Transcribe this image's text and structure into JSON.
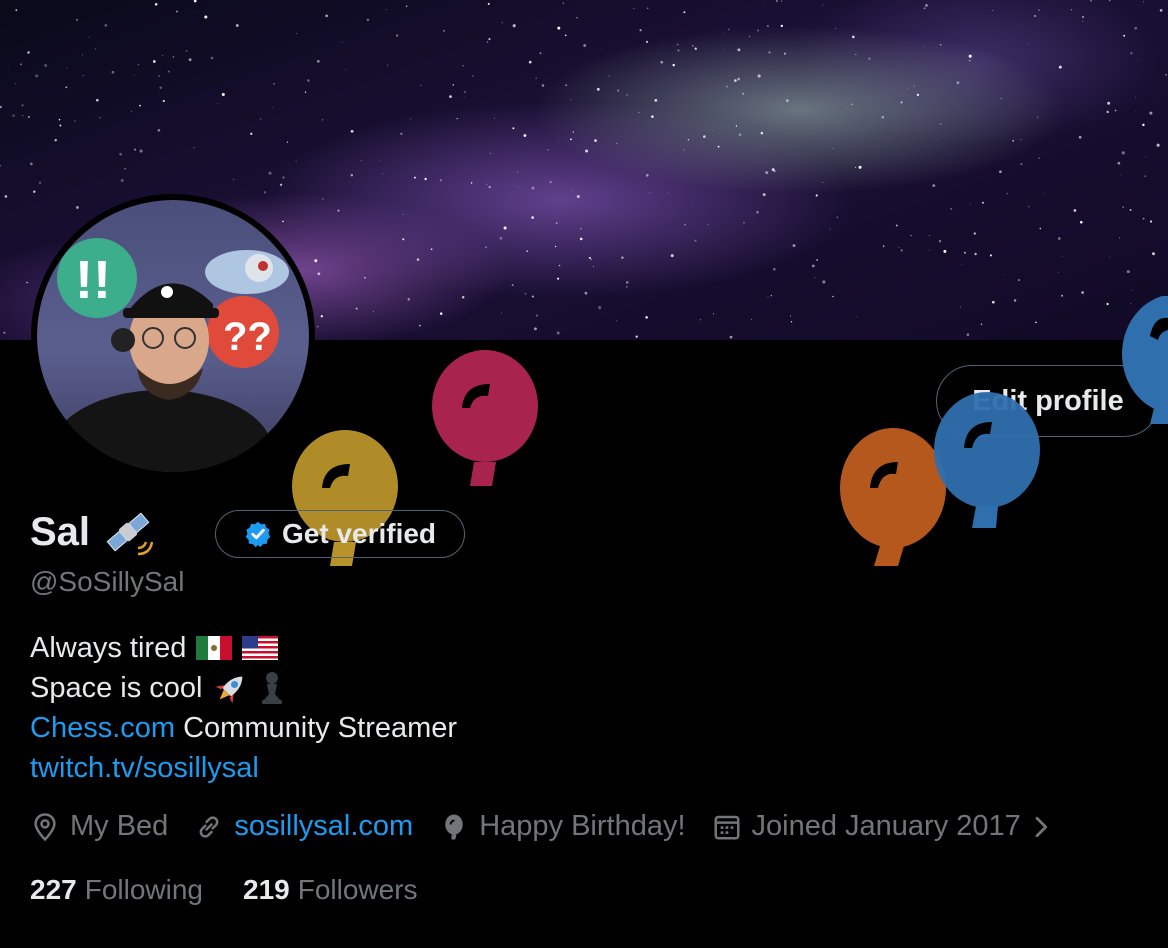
{
  "profile": {
    "name": "Sal",
    "handle": "@SoSillySal",
    "edit_profile_label": "Edit profile",
    "get_verified_label": "Get verified",
    "name_emoji_icon": "satellite-icon",
    "bio": {
      "line1": "Always tired",
      "line2": "Space is cool",
      "line3_link": "Chess.com",
      "line3_text": " Community Streamer",
      "line4_link": "twitch.tv/sosillysal"
    },
    "meta": {
      "location": "My Bed",
      "website": "sosillysal.com",
      "birthday": "Happy Birthday!",
      "joined": "Joined January 2017"
    },
    "stats": {
      "following_count": "227",
      "following_label": "Following",
      "followers_count": "219",
      "followers_label": "Followers"
    }
  },
  "colors": {
    "background": "#000000",
    "text_primary": "#e7e9ea",
    "text_secondary": "#71767b",
    "link": "#1d9bf0",
    "border": "#536471",
    "balloon_pink": "#a8234e",
    "balloon_yellow": "#b8932a",
    "balloon_orange": "#b5581e",
    "balloon_blue": "#2f6fae"
  }
}
